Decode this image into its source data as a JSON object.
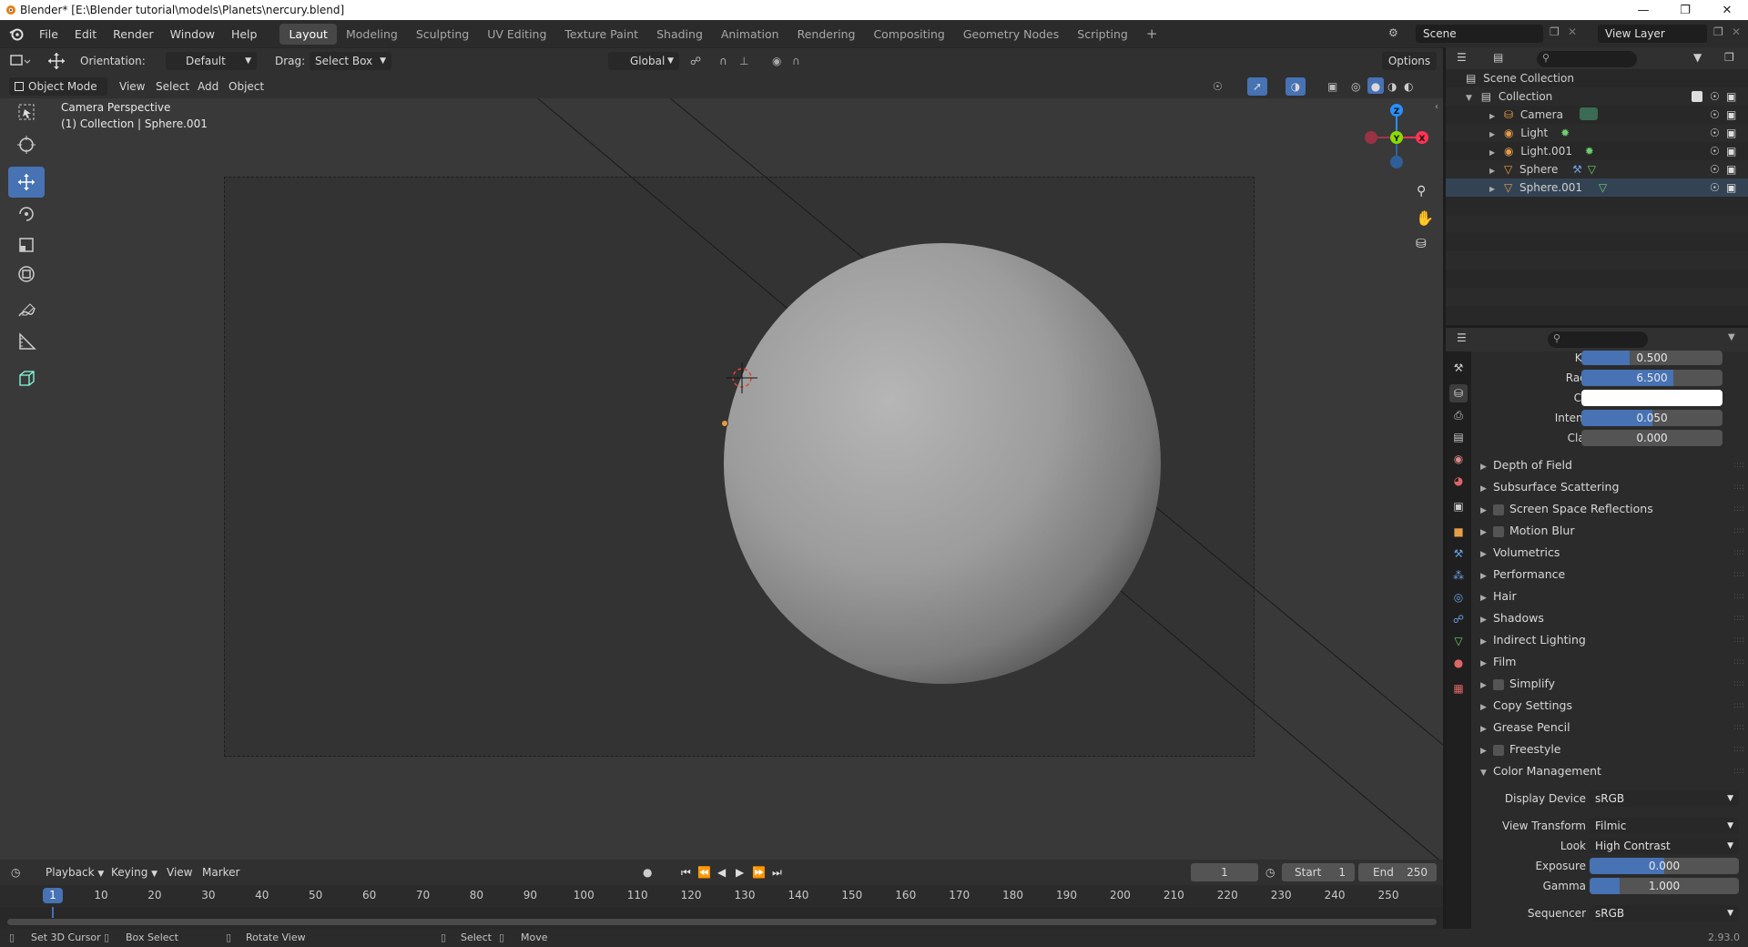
{
  "window": {
    "title": "Blender* [E:\\Blender tutorial\\models\\Planets\\nercury.blend]"
  },
  "menu": [
    "File",
    "Edit",
    "Render",
    "Window",
    "Help"
  ],
  "workspaces": [
    "Layout",
    "Modeling",
    "Sculpting",
    "UV Editing",
    "Texture Paint",
    "Shading",
    "Animation",
    "Rendering",
    "Compositing",
    "Geometry Nodes",
    "Scripting"
  ],
  "active_workspace": "Layout",
  "scene": {
    "name": "Scene",
    "view_layer": "View Layer"
  },
  "header": {
    "orientation_label": "Orientation:",
    "orientation_value": "Default",
    "drag_label": "Drag:",
    "drag_value": "Select Box",
    "transform_orientation": "Global",
    "options": "Options"
  },
  "viewport_header": {
    "mode": "Object Mode",
    "menus": [
      "View",
      "Select",
      "Add",
      "Object"
    ]
  },
  "viewport": {
    "overlay_line1": "Camera Perspective",
    "overlay_line2": "(1) Collection | Sphere.001"
  },
  "gizmo": {
    "z": "Z",
    "y": "Y",
    "x": "X"
  },
  "outliner": {
    "root": "Scene Collection",
    "collection": "Collection",
    "items": [
      {
        "name": "Camera",
        "type": "camera"
      },
      {
        "name": "Light",
        "type": "light"
      },
      {
        "name": "Light.001",
        "type": "light"
      },
      {
        "name": "Sphere",
        "type": "mesh"
      },
      {
        "name": "Sphere.001",
        "type": "mesh"
      }
    ]
  },
  "properties": {
    "fields": [
      {
        "label": "Knee",
        "value": "0.500",
        "fill": 0.34
      },
      {
        "label": "Radius",
        "value": "6.500",
        "fill": 0.65
      },
      {
        "label": "Color",
        "value": "",
        "color": "#ffffff"
      },
      {
        "label": "Intensity",
        "value": "0.050",
        "fill": 0.5
      },
      {
        "label": "Clamp",
        "value": "0.000",
        "fill": 0
      }
    ],
    "panels": [
      {
        "label": "Depth of Field",
        "checkbox": false
      },
      {
        "label": "Subsurface Scattering",
        "checkbox": false
      },
      {
        "label": "Screen Space Reflections",
        "checkbox": true
      },
      {
        "label": "Motion Blur",
        "checkbox": true
      },
      {
        "label": "Volumetrics",
        "checkbox": false
      },
      {
        "label": "Performance",
        "checkbox": false
      },
      {
        "label": "Hair",
        "checkbox": false
      },
      {
        "label": "Shadows",
        "checkbox": false
      },
      {
        "label": "Indirect Lighting",
        "checkbox": false
      },
      {
        "label": "Film",
        "checkbox": false
      },
      {
        "label": "Simplify",
        "checkbox": true
      },
      {
        "label": "Copy Settings",
        "checkbox": false
      },
      {
        "label": "Grease Pencil",
        "checkbox": false
      },
      {
        "label": "Freestyle",
        "checkbox": true
      }
    ],
    "color_management": {
      "label": "Color Management",
      "display_device_label": "Display Device",
      "display_device": "sRGB",
      "view_transform_label": "View Transform",
      "view_transform": "Filmic",
      "look_label": "Look",
      "look": "High Contrast",
      "exposure_label": "Exposure",
      "exposure": "0.000",
      "gamma_label": "Gamma",
      "gamma": "1.000",
      "sequencer_label": "Sequencer",
      "sequencer": "sRGB"
    }
  },
  "timeline": {
    "menus": [
      "Playback",
      "Keying",
      "View",
      "Marker"
    ],
    "current_frame": "1",
    "start_label": "Start",
    "start": "1",
    "end_label": "End",
    "end": "250",
    "ticks": [
      "1",
      "10",
      "20",
      "30",
      "40",
      "50",
      "60",
      "70",
      "80",
      "90",
      "100",
      "110",
      "120",
      "130",
      "140",
      "150",
      "160",
      "170",
      "180",
      "190",
      "200",
      "210",
      "220",
      "230",
      "240",
      "250"
    ]
  },
  "statusbar": {
    "items": [
      "Set 3D Cursor",
      "Box Select",
      "Rotate View",
      "Select",
      "Move"
    ],
    "version": "2.93.0"
  },
  "colors": {
    "accent": "#4772b3",
    "x_axis": "#ff3352",
    "y_axis": "#8bdc00",
    "z_axis": "#2890ff"
  }
}
